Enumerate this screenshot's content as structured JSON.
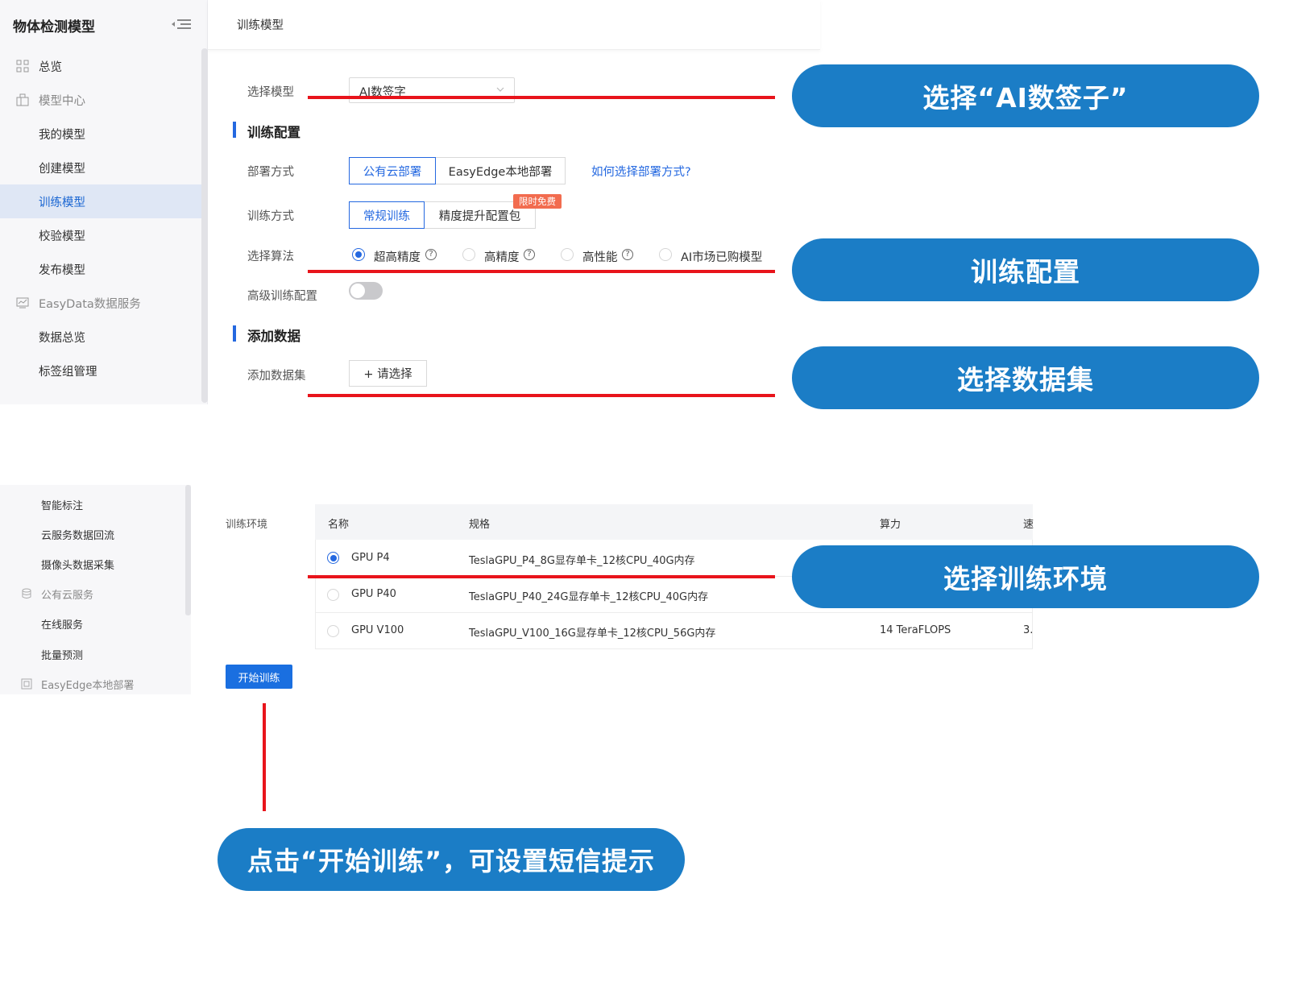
{
  "sidebar": {
    "title": "物体检测模型",
    "items": [
      {
        "label": "总览"
      },
      {
        "label": "模型中心"
      },
      {
        "label": "我的模型"
      },
      {
        "label": "创建模型"
      },
      {
        "label": "训练模型"
      },
      {
        "label": "校验模型"
      },
      {
        "label": "发布模型"
      },
      {
        "label": "EasyData数据服务"
      },
      {
        "label": "数据总览"
      },
      {
        "label": "标签组管理"
      }
    ]
  },
  "header": {
    "title": "训练模型"
  },
  "form": {
    "select_model_label": "选择模型",
    "select_model_value": "AI数签字",
    "section_train_config": "训练配置",
    "deploy_label": "部署方式",
    "deploy_options": [
      "公有云部署",
      "EasyEdge本地部署"
    ],
    "deploy_help_link": "如何选择部署方式?",
    "train_mode_label": "训练方式",
    "train_mode_options": [
      "常规训练",
      "精度提升配置包"
    ],
    "free_badge": "限时免费",
    "algorithm_label": "选择算法",
    "algorithms": [
      "超高精度",
      "高精度",
      "高性能",
      "AI市场已购模型"
    ],
    "help_glyph": "?",
    "advanced_label": "高级训练配置",
    "section_add_data": "添加数据",
    "add_dataset_label": "添加数据集",
    "add_dataset_button": "+ 请选择"
  },
  "bottom_sidebar": {
    "items": [
      {
        "label": "智能标注"
      },
      {
        "label": "云服务数据回流"
      },
      {
        "label": "摄像头数据采集"
      },
      {
        "label": "公有云服务"
      },
      {
        "label": "在线服务"
      },
      {
        "label": "批量预测"
      },
      {
        "label": "EasyEdge本地部署"
      }
    ]
  },
  "env": {
    "label": "训练环境",
    "columns": [
      "名称",
      "规格",
      "算力",
      "速"
    ],
    "rows": [
      {
        "name": "GPU P4",
        "spec": "TeslaGPU_P4_8G显存单卡_12核CPU_40G内存",
        "power": "",
        "speed": ""
      },
      {
        "name": "GPU P40",
        "spec": "TeslaGPU_P40_24G显存单卡_12核CPU_40G内存",
        "power": "",
        "speed": ""
      },
      {
        "name": "GPU V100",
        "spec": "TeslaGPU_V100_16G显存单卡_12核CPU_56G内存",
        "power": "14 TeraFLOPS",
        "speed": "3."
      }
    ],
    "selected_row": 0,
    "start_button": "开始训练"
  },
  "callouts": {
    "select_model": "选择“AI数签子”",
    "train_config": "训练配置",
    "select_dataset": "选择数据集",
    "select_env": "选择训练环境",
    "start_training": "点击“开始训练”，可设置短信提示"
  },
  "colors": {
    "accent": "#2468e0",
    "callout": "#1b7dc6",
    "annotation_red": "#e8141b",
    "badge": "#f26c4f"
  }
}
